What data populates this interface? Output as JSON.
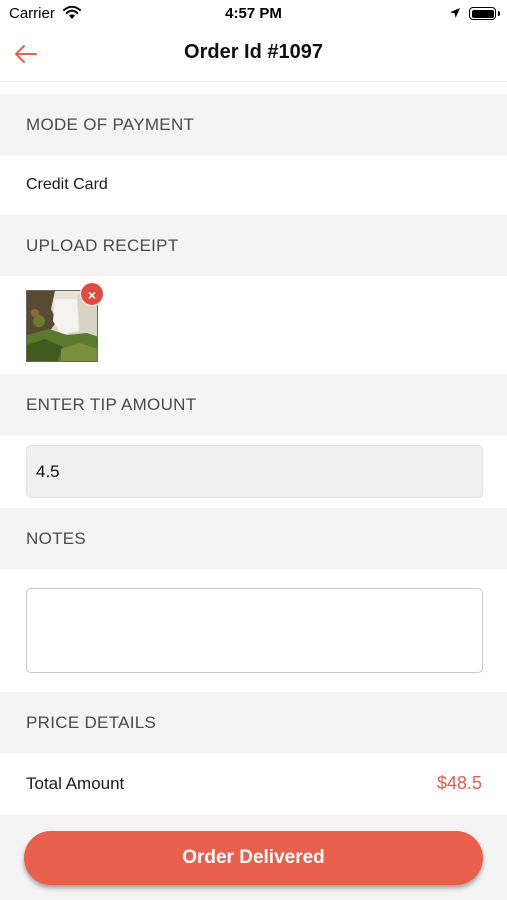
{
  "status_bar": {
    "carrier": "Carrier",
    "time": "4:57 PM"
  },
  "nav": {
    "title": "Order Id #1097"
  },
  "payment": {
    "header": "MODE OF PAYMENT",
    "value": "Credit Card"
  },
  "receipt": {
    "header": "UPLOAD RECEIPT",
    "remove_glyph": "×"
  },
  "tip": {
    "header": "ENTER TIP AMOUNT",
    "value": "4.5"
  },
  "notes": {
    "header": "NOTES",
    "value": ""
  },
  "price": {
    "header": "PRICE DETAILS",
    "total_label": "Total Amount",
    "total_value": "$48.5"
  },
  "actions": {
    "primary_label": "Order Delivered"
  },
  "colors": {
    "accent": "#e8604c",
    "price_text": "#e35c46",
    "section_bg": "#f4f4f4",
    "remove_badge": "#e14b3f"
  }
}
